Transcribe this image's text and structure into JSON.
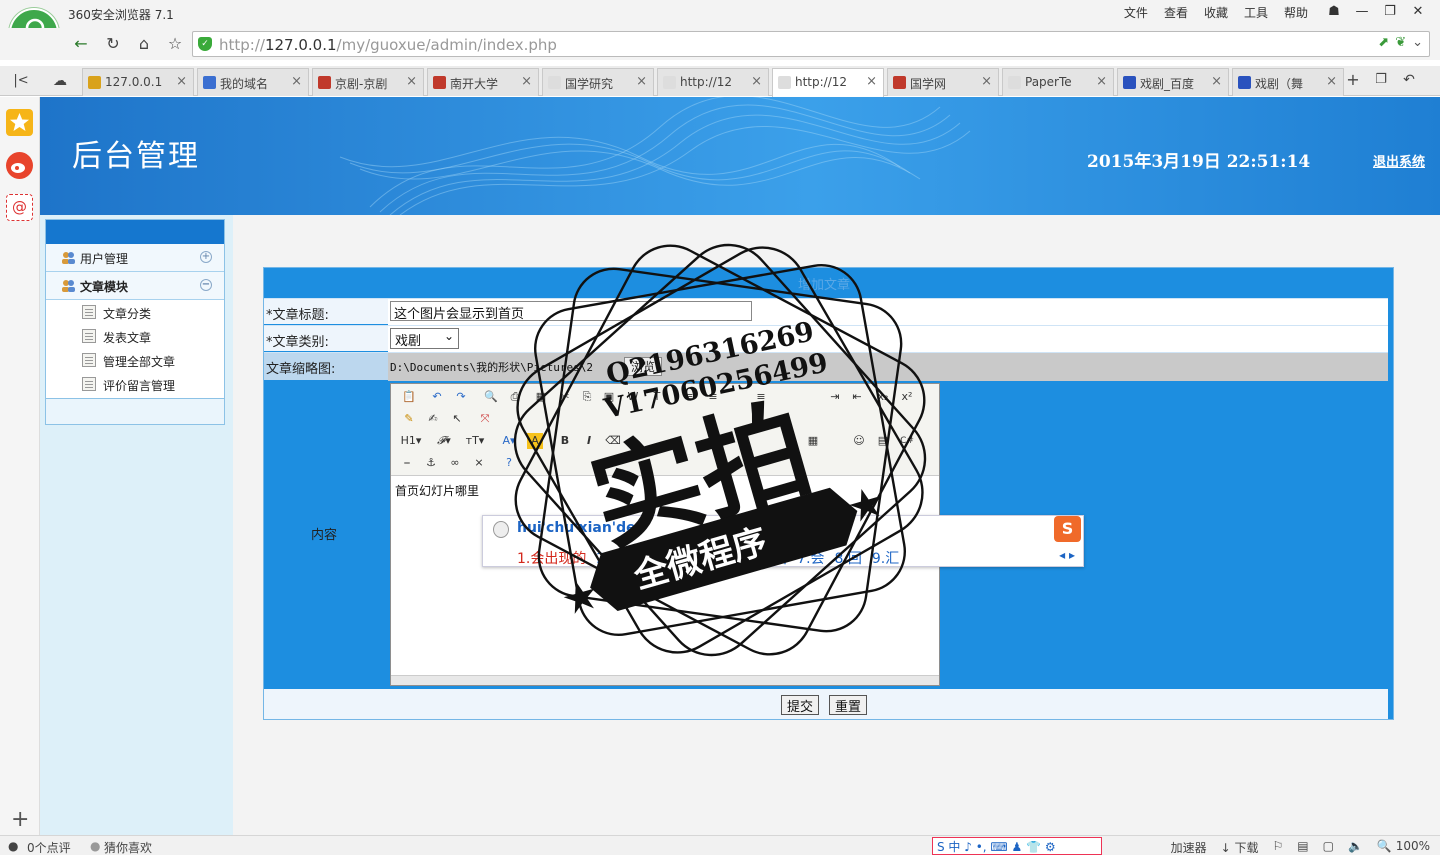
{
  "browser": {
    "app_title": "360安全浏览器 7.1",
    "menu": [
      "文件",
      "查看",
      "收藏",
      "工具",
      "帮助"
    ],
    "url_prefix": "http://",
    "url_host": "127.0.0.1",
    "url_path": "/my/guoxue/admin/index.php",
    "tabs": [
      {
        "label": "127.0.0.1",
        "icon_color": "#d9a21b"
      },
      {
        "label": "我的域名",
        "icon_color": "#3b6fd1"
      },
      {
        "label": "京剧-京剧",
        "icon_color": "#c0392b"
      },
      {
        "label": "南开大学",
        "icon_color": "#c0392b"
      },
      {
        "label": "国学研究",
        "icon_color": "#dddddd"
      },
      {
        "label": "http://12",
        "icon_color": "#dddddd"
      },
      {
        "label": "http://12",
        "icon_color": "#dddddd"
      },
      {
        "label": "国学网",
        "icon_color": "#c0392b"
      },
      {
        "label": "PaperTe",
        "icon_color": "#dddddd"
      },
      {
        "label": "戏剧_百度",
        "icon_color": "#2a52be"
      },
      {
        "label": "戏剧（舞",
        "icon_color": "#2a52be"
      }
    ],
    "active_tab_index": 6
  },
  "site": {
    "title": "后台管理",
    "datetime": "2015年3月19日  22:51:14",
    "logout": "退出系统"
  },
  "menu": {
    "groups": [
      {
        "label": "用户管理",
        "toggle": "+"
      },
      {
        "label": "文章模块",
        "toggle": "−"
      }
    ],
    "sub_items": [
      "文章分类",
      "发表文章",
      "管理全部文章",
      "评价留言管理"
    ]
  },
  "form": {
    "heading": "增加文章",
    "title_label": "*文章标题:",
    "title_value": "这个图片会显示到首页",
    "category_label": "*文章类别:",
    "category_value": "戏剧",
    "thumb_label": "文章缩略图:",
    "thumb_path": "D:\\Documents\\我的形状\\Pictures\\2",
    "thumb_browse": "浏览",
    "content_label": "内容",
    "editor_text": "首页幻灯片哪里",
    "submit": "提交",
    "reset": "重置"
  },
  "ime": {
    "composition": "hui'chu'xian'de",
    "candidates": [
      "1.会出现的",
      "2.会出",
      "3.",
      "4.",
      "5.绘出",
      "6.挥出",
      "7.会",
      "8.回",
      "9.汇"
    ],
    "logo": "S"
  },
  "watermark": {
    "qq1": "Q2196316269",
    "qq2": "V17060256499",
    "main": "实拍",
    "banner": "全微程序"
  },
  "status": {
    "left1": "0个点评",
    "left2": "猜你喜欢",
    "ime_bar": "S 中 ♪ •, ⌨ ♟ 👕 ⚙",
    "accelerator": "加速器",
    "download": "下载",
    "zoom": "100%"
  }
}
